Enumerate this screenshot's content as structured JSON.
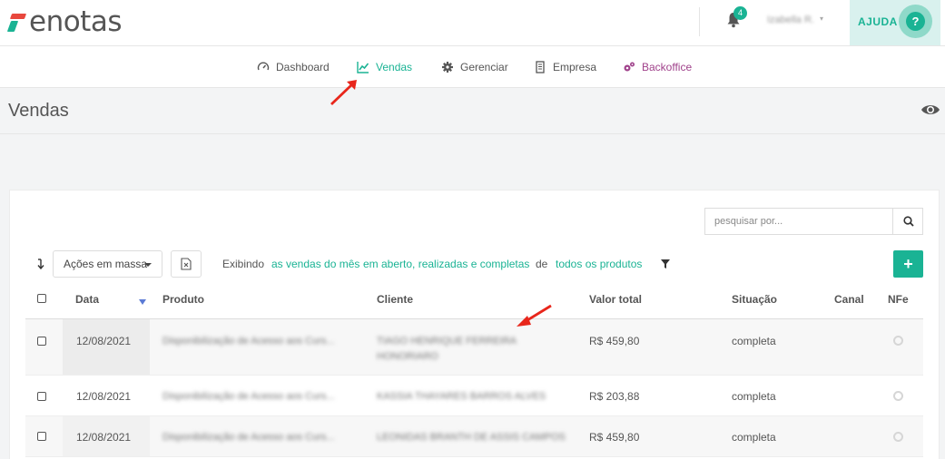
{
  "header": {
    "logo_text": "enotas",
    "notification_count": "4",
    "user_name": "Izabella R.",
    "help_label": "AJUDA",
    "help_icon_glyph": "?"
  },
  "nav": {
    "items": [
      {
        "label": "Dashboard",
        "icon": "gauge-icon"
      },
      {
        "label": "Vendas",
        "icon": "chart-line-icon",
        "active": true
      },
      {
        "label": "Gerenciar",
        "icon": "gear-icon"
      },
      {
        "label": "Empresa",
        "icon": "building-icon"
      },
      {
        "label": "Backoffice",
        "icon": "gears-icon"
      }
    ]
  },
  "page": {
    "title": "Vendas"
  },
  "toolbar": {
    "search_placeholder": "pesquisar por...",
    "mass_actions_label": "Ações em massa",
    "filter_prefix": "Exibindo",
    "filter_period": "as vendas do mês",
    "filter_status": "em aberto, realizadas e completas",
    "filter_connector": "de",
    "filter_products": "todos os produtos",
    "add_label": "+"
  },
  "table": {
    "columns": [
      "Data",
      "Produto",
      "Cliente",
      "Valor total",
      "Situação",
      "Canal",
      "NFe"
    ],
    "rows": [
      {
        "date": "12/08/2021",
        "product": "Disponibilização de Acesso aos Curs...",
        "client_line1": "TIAGO HENRIQUE FERREIRA",
        "client_line2": "HONORIARO",
        "total": "R$ 459,80",
        "status": "completa"
      },
      {
        "date": "12/08/2021",
        "product": "Disponibilização de Acesso aos Curs...",
        "client_line1": "KASSIA THAYARES BARROS ALVES",
        "client_line2": "",
        "total": "R$ 203,88",
        "status": "completa"
      },
      {
        "date": "12/08/2021",
        "product": "Disponibilização de Acesso aos Curs...",
        "client_line1": "LEONIDAS BRANTH DE ASSIS CAMPOS",
        "client_line2": "",
        "total": "R$ 459,80",
        "status": "completa"
      }
    ]
  },
  "colors": {
    "accent": "#1ab394",
    "backoffice": "#a0428b",
    "annotation_arrow": "#e8261b"
  }
}
